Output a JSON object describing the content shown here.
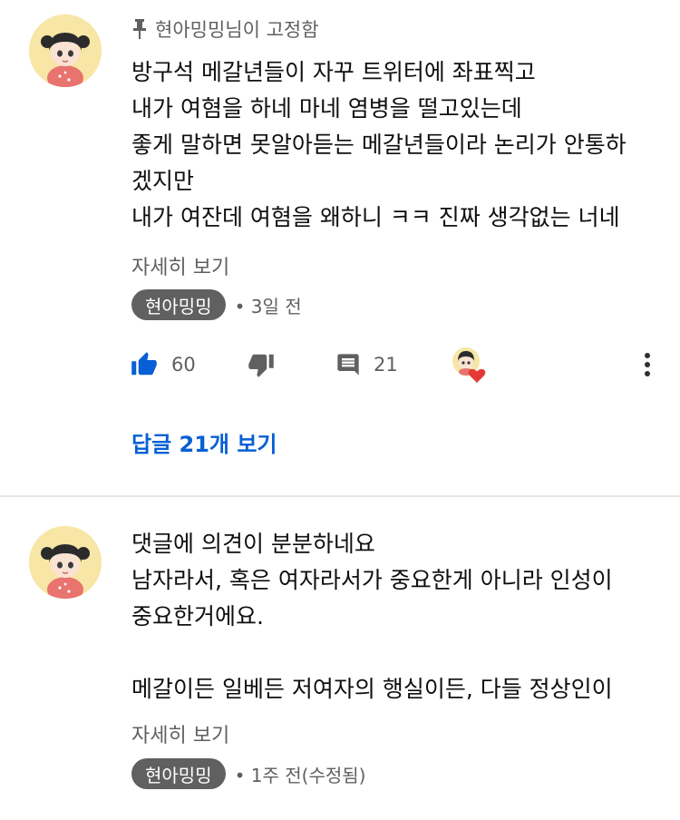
{
  "comment1": {
    "pinned_text": "현아밍밍님이 고정함",
    "lines": [
      "방구석 메갈년들이 자꾸 트위터에 좌표찍고",
      "내가 여혐을 하네 마네 염병을 떨고있는데",
      "좋게 말하면 못알아듣는 메갈년들이라 논리가 안통하",
      "겠지만",
      "내가 여잔데 여혐을 왜하니 ㅋㅋ 진짜 생각없는 너네"
    ],
    "read_more": "자세히 보기",
    "author": "현아밍밍",
    "time": "• 3일 전",
    "likes": "60",
    "replies_count": "21",
    "view_replies": "답글 21개 보기"
  },
  "comment2": {
    "lines": [
      "댓글에 의견이 분분하네요",
      "남자라서, 혹은 여자라서가 중요한게 아니라 인성이",
      "중요한거에요.",
      "",
      "메갈이든 일베든 저여자의 행실이든, 다들 정상인이"
    ],
    "read_more": "자세히 보기",
    "author": "현아밍밍",
    "time": "• 1주 전(수정됨)"
  },
  "colors": {
    "link_blue": "#065fd4",
    "like_blue": "#065fd4",
    "secondary_text": "#606060",
    "heart_red": "#e53935",
    "avatar_bg": "#f7e6a6"
  },
  "icons": [
    "pin-icon",
    "thumbs-up-icon",
    "thumbs-down-icon",
    "reply-comment-icon",
    "creator-heart-icon",
    "more-vert-icon"
  ]
}
